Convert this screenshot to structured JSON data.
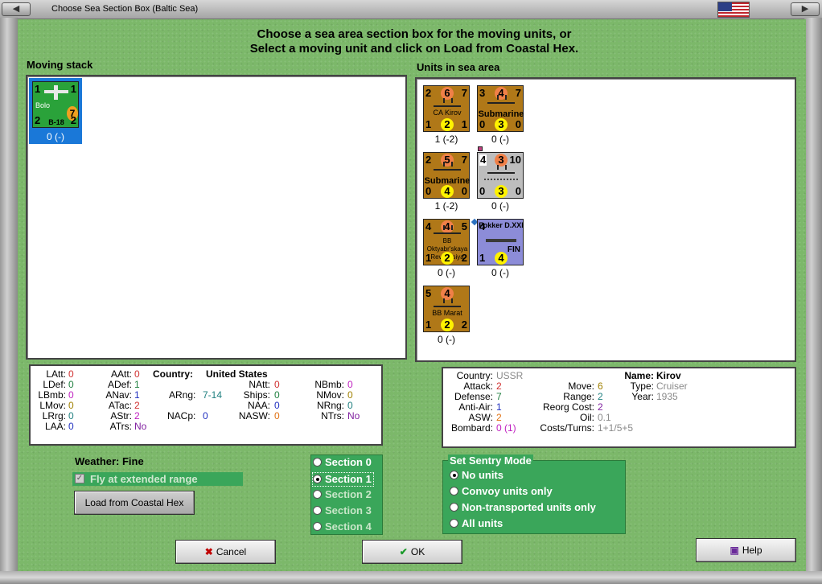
{
  "window": {
    "title": "Choose Sea Section Box (Baltic Sea)",
    "nav_left_label": "◀",
    "nav_right_label": "▶",
    "flag": "us-flag-icon"
  },
  "header": {
    "line1": "Choose a sea area section box for the moving units, or",
    "line2": "Select a moving unit and click on Load from Coastal Hex."
  },
  "moving_stack": {
    "label": "Moving stack",
    "units": [
      {
        "tl": "1",
        "tr": "1",
        "bl": "2",
        "br": "2",
        "name": "Bolo",
        "type": "B-18",
        "badge": "7",
        "caption": "0 (-)",
        "color": "#2aa23a"
      }
    ]
  },
  "sea_area": {
    "label": "Units in sea area",
    "units": [
      {
        "tl": "2",
        "tc": "6",
        "tr": "7",
        "bl": "1",
        "bc": "2",
        "br": "1",
        "name": "CA Kirov",
        "caption": "1 (-2)"
      },
      {
        "tl": "3",
        "tc": "4",
        "tr": "7",
        "bl": "0",
        "bc": "3",
        "br": "0",
        "name": "Submarine",
        "caption": "0 (-)"
      },
      {
        "tl": "2",
        "tc": "5",
        "tr": "7",
        "bl": "0",
        "bc": "4",
        "br": "0",
        "name": "Submarine",
        "caption": "1 (-2)"
      },
      {
        "tl": "4",
        "tc": "3",
        "tr": "10",
        "bl": "0",
        "bc": "3",
        "br": "0",
        "name": "",
        "caption": "0 (-)"
      },
      {
        "tl": "4",
        "tc": "4",
        "tr": "5",
        "bl": "1",
        "bc": "2",
        "br": "2",
        "name": "BB Oktyabr'skaya Revolutsiya",
        "caption": "0 (-)"
      },
      {
        "tl": "4",
        "tc": "",
        "tr": "",
        "bl": "1",
        "bc": "4",
        "br": "",
        "name": "Fokker D.XXI",
        "tag": "FIN",
        "caption": "0 (-)"
      },
      {
        "tl": "5",
        "tc": "4",
        "tr": "",
        "bl": "1",
        "bc": "2",
        "br": "2",
        "name": "BB Marat",
        "caption": "0 (-)"
      }
    ]
  },
  "left_info": {
    "LAtt": "0",
    "LDef": "0",
    "LBmb": "0",
    "LMov": "0",
    "LRrg": "0",
    "LAA": "0",
    "AAtt": "0",
    "ADef": "1",
    "ANav": "1",
    "ATac": "2",
    "AStr": "2",
    "ATrs": "No",
    "country_label": "Country:",
    "country": "United States",
    "ARng_label": "ARng:",
    "ARng": "7-14",
    "NACp_label": "NACp:",
    "NACp": "0",
    "NAtt": "0",
    "Ships": "0",
    "NAA": "0",
    "NASW": "0",
    "NBmb": "0",
    "NMov": "0",
    "NRng": "0",
    "NTrs": "No"
  },
  "right_info": {
    "country_label": "Country:",
    "country": "USSR",
    "attack_label": "Attack:",
    "attack": "2",
    "defense_label": "Defense:",
    "defense": "7",
    "antiair_label": "Anti-Air:",
    "antiair": "1",
    "asw_label": "ASW:",
    "asw": "2",
    "bombard_label": "Bombard:",
    "bombard": "0 (1)",
    "move_label": "Move:",
    "move": "6",
    "range_label": "Range:",
    "range": "2",
    "reorg_label": "Reorg Cost:",
    "reorg": "2",
    "oil_label": "Oil:",
    "oil": "0.1",
    "costs_label": "Costs/Turns:",
    "costs": "1+1/5+5",
    "name_label": "Name:",
    "name": "Kirov",
    "type_label": "Type:",
    "type": "Cruiser",
    "year_label": "Year:",
    "year": "1935"
  },
  "weather": {
    "label": "Weather: Fine"
  },
  "fly_extended": {
    "label": "Fly at extended range",
    "checked": true
  },
  "load_button": "Load from Coastal Hex",
  "sections": {
    "options": [
      "Section 0",
      "Section 1",
      "Section 2",
      "Section 3",
      "Section 4"
    ],
    "selected": "Section 1"
  },
  "sentry": {
    "title": "Set Sentry Mode",
    "options": [
      "No units",
      "Convoy units only",
      "Non-transported units only",
      "All units"
    ],
    "selected": "No units"
  },
  "buttons": {
    "cancel": "Cancel",
    "ok": "OK",
    "help": "Help"
  },
  "colors": {
    "felt": "#7cb86a",
    "counter_brown": "#b07818",
    "selection": "#1a78d8",
    "radio_group": "#3aa65a",
    "fokker": "#8c8cd8"
  }
}
